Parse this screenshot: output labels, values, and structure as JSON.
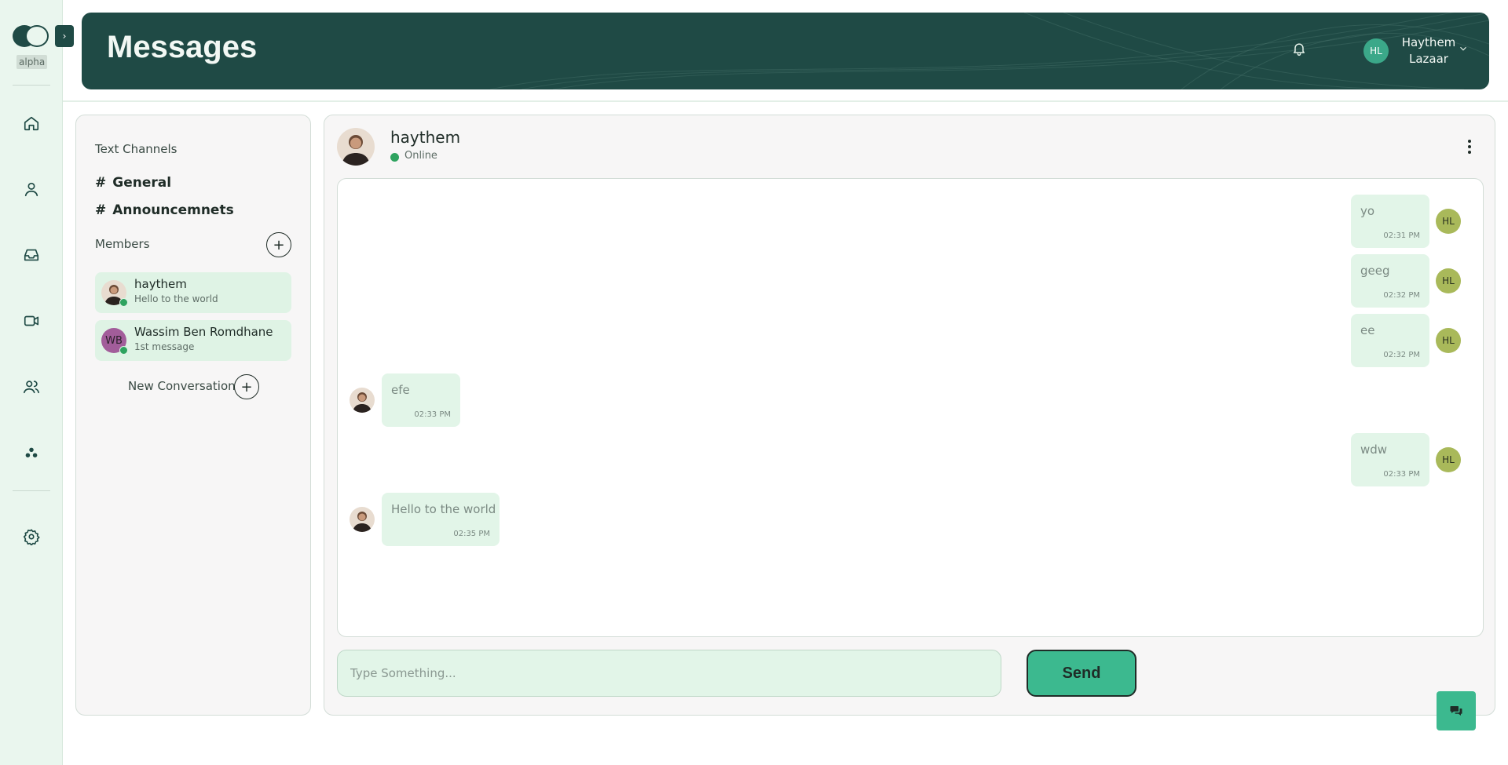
{
  "brand": {
    "tag": "alpha"
  },
  "header": {
    "title": "Messages",
    "user": {
      "initials": "HL",
      "name": "Haythem Lazaar"
    }
  },
  "nav": {
    "icons": [
      "home-icon",
      "profile-icon",
      "inbox-icon",
      "video-icon",
      "team-icon",
      "community-icon",
      "settings-icon"
    ]
  },
  "channels": {
    "section_label": "Text Channels",
    "items": [
      {
        "hash": "#",
        "label": "General"
      },
      {
        "hash": "#",
        "label": "Announcemnets"
      }
    ],
    "members_label": "Members",
    "members": [
      {
        "name": "haythem",
        "last_message": "Hello to the world",
        "initials": ""
      },
      {
        "name": "Wassim Ben Romdhane",
        "last_message": "1st message",
        "initials": "WB"
      }
    ],
    "new_conversation_label": "New Conversation"
  },
  "chat": {
    "contact": {
      "name": "haythem",
      "status": "Online"
    },
    "messages": [
      {
        "text": "yo",
        "time": "02:31 PM",
        "sender": "me",
        "initials": "HL"
      },
      {
        "text": "geeg",
        "time": "02:32 PM",
        "sender": "me",
        "initials": "HL"
      },
      {
        "text": "ee",
        "time": "02:32 PM",
        "sender": "me",
        "initials": "HL"
      },
      {
        "text": "efe",
        "time": "02:33 PM",
        "sender": "them"
      },
      {
        "text": "wdw",
        "time": "02:33 PM",
        "sender": "me",
        "initials": "HL"
      },
      {
        "text": "Hello to the world",
        "time": "02:35 PM",
        "sender": "them"
      }
    ],
    "input": {
      "placeholder": "Type Something...",
      "value": ""
    },
    "send_label": "Send"
  },
  "colors": {
    "primary_dark": "#1f4a45",
    "accent": "#3cb98f",
    "bubble": "#e2f5e8",
    "online": "#2ea35f",
    "my_avatar": "#a9b95a"
  }
}
